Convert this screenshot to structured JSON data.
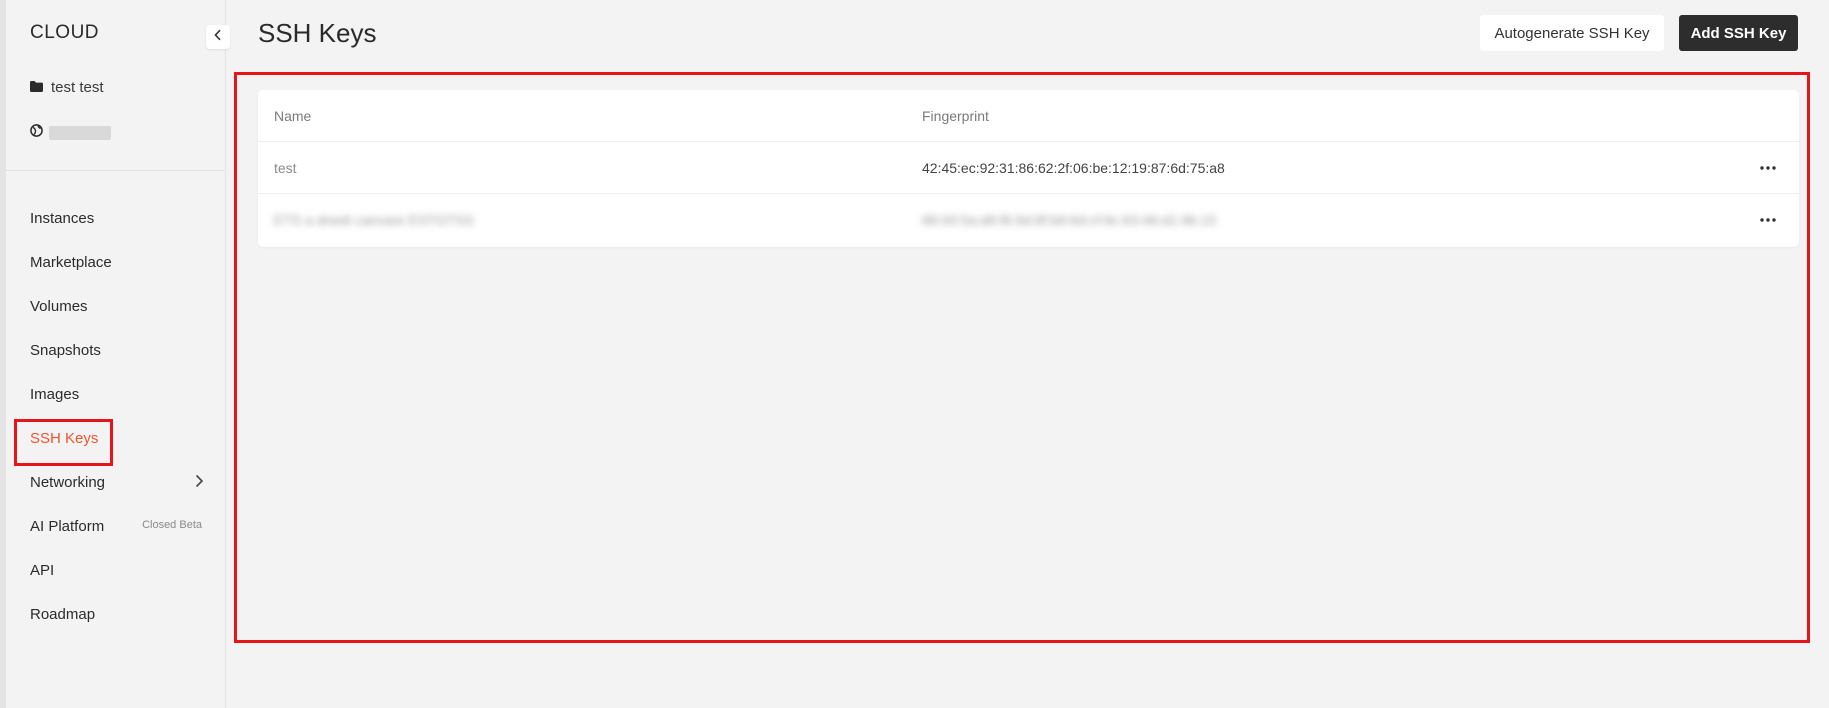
{
  "app": {
    "brand": "CLOUD",
    "project_name": "test test"
  },
  "sidebar": {
    "items": [
      {
        "label": "Instances"
      },
      {
        "label": "Marketplace"
      },
      {
        "label": "Volumes"
      },
      {
        "label": "Snapshots"
      },
      {
        "label": "Images"
      },
      {
        "label": "SSH Keys",
        "active": true
      },
      {
        "label": "Networking",
        "has_submenu": true
      },
      {
        "label": "AI Platform",
        "badge": "Closed Beta"
      },
      {
        "label": "API"
      },
      {
        "label": "Roadmap"
      }
    ]
  },
  "header": {
    "title": "SSH Keys",
    "autogenerate_label": "Autogenerate SSH Key",
    "add_label": "Add SSH Key"
  },
  "table": {
    "columns": [
      "Name",
      "Fingerprint"
    ],
    "rows": [
      {
        "name": "test",
        "fingerprint": "42:45:ec:92:31:86:62:2f:06:be:12:19:87:6d:75:a8"
      },
      {
        "name": "ETS a dnedi canvare ESTGTSS",
        "fingerprint": "88:00:5a:d8:f6:9d:8f:b8:6d:cf:8c:63:46:d1:9b:15",
        "blurred": true
      }
    ]
  },
  "colors": {
    "accent": "#f0542d",
    "highlight": "#e8141b",
    "primary_button": "#2d2d2d",
    "background": "#f3f3f3"
  },
  "icons": {
    "project": "folder-icon",
    "account": "globe-icon",
    "collapse": "chevron-left-icon",
    "submenu": "chevron-right-icon",
    "row_menu": "more-horizontal-icon"
  }
}
